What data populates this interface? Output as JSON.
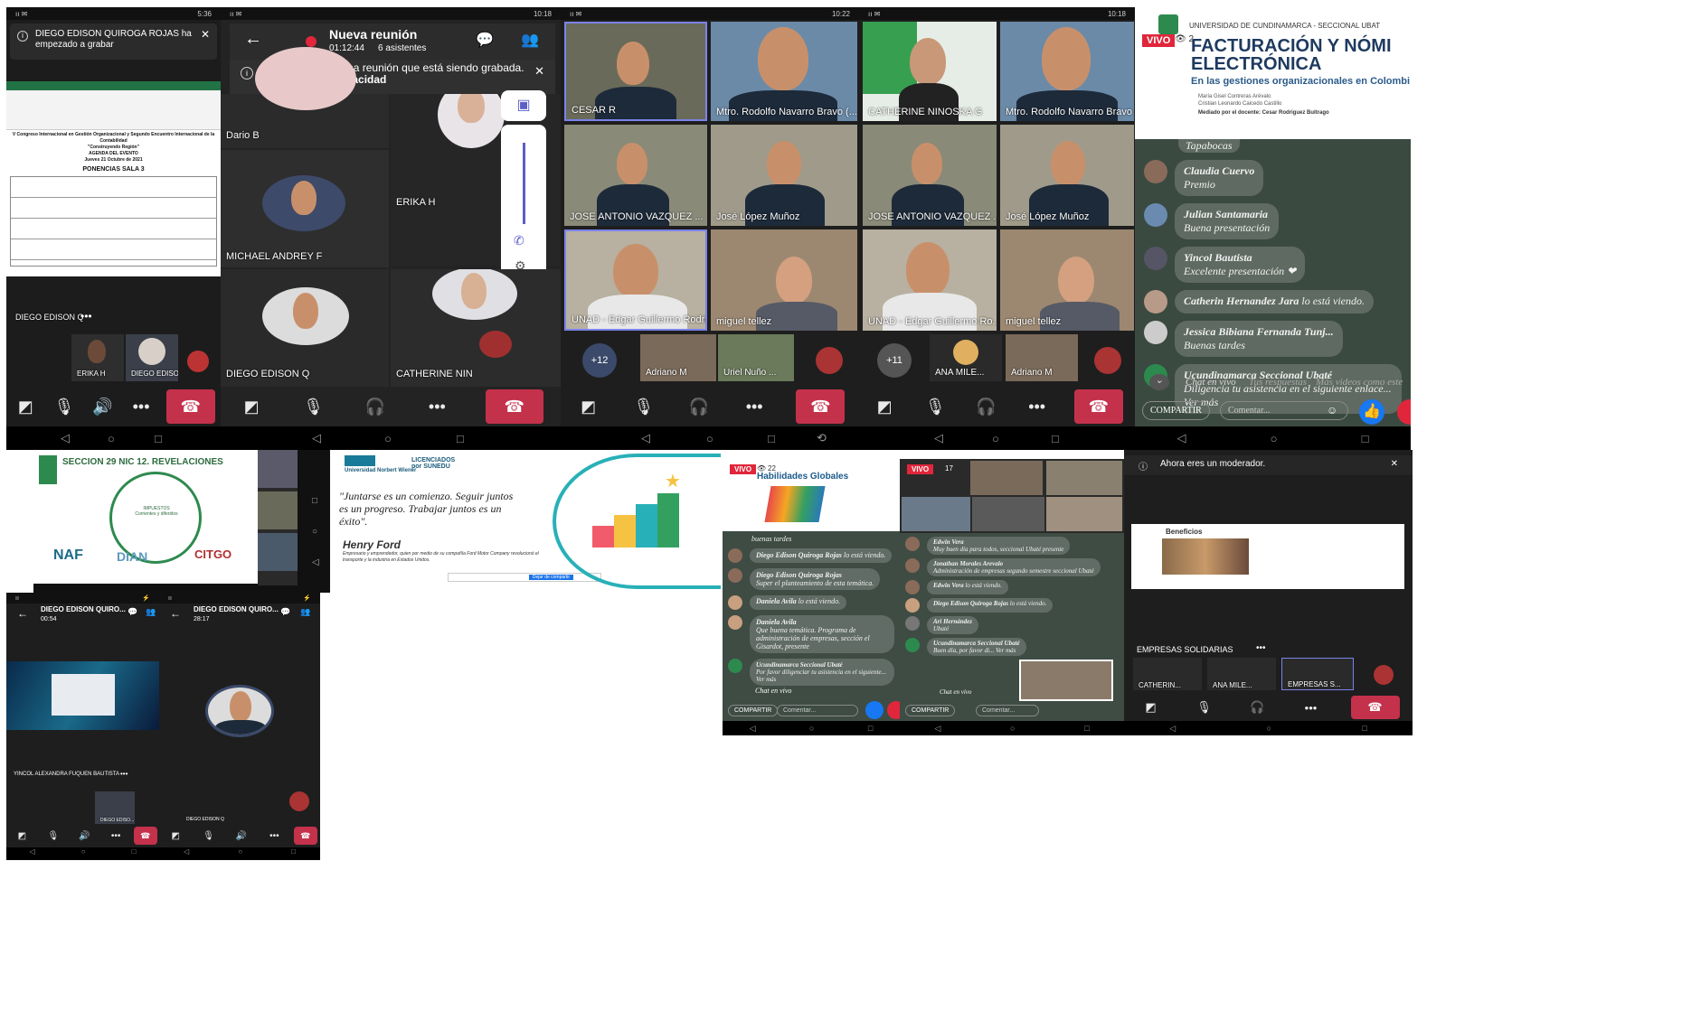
{
  "p1": {
    "status_time": "5:36",
    "notification": "DIEGO EDISON QUIROGA ROJAS ha empezado a grabar",
    "sheet_title": "V Congreso Internacional en Gestión Organizacional y Segundo Encuentro Internacional de la Contabilidad",
    "sheet_sub1": "\"Construyendo Región\"",
    "sheet_sub2": "AGENDA DEL EVENTO",
    "sheet_sub3": "Jueves 21 Octubre de 2021",
    "sheet_heading": "PONENCIAS SALA 3",
    "presenter": "DIEGO EDISON Q",
    "thumb1": "ERIKA H",
    "thumb2": "DIEGO EDISO..."
  },
  "p2": {
    "status_time": "10:18",
    "title": "Nueva reunión",
    "timer": "01:12:44",
    "attendees": "6 asistentes",
    "banner": "Te has unido a una reunión que está siendo grabada.",
    "banner_link": "Directiva de privacidad",
    "names": [
      "Dario B",
      "ERIKA H",
      "MICHAEL ANDREY F",
      "DIEGO EDISON Q",
      "CATHERINE NIN"
    ]
  },
  "p3": {
    "status_time": "10:22",
    "tiles": [
      "CESAR R",
      "Mtro. Rodolfo Navarro Bravo (...",
      "JOSE ANTONIO VAZQUEZ ...",
      "José López Muñoz",
      "UNAD - Edgar Guillermo Rodri...",
      "miguel tellez"
    ],
    "strip": [
      "+12",
      "Adriano M",
      "Uriel Nuño ..."
    ]
  },
  "p4": {
    "status_time": "10:18",
    "tiles": [
      "CATHERINE NINOSKA G",
      "Mtro. Rodolfo Navarro Bravo (...",
      "JOSE ANTONIO VAZQUEZ ...",
      "José López Muñoz",
      "UNAD - Edgar Guillermo Ro...",
      "miguel tellez"
    ],
    "strip": [
      "+11",
      "ANA MILE...",
      "Adriano M"
    ]
  },
  "p5": {
    "vivo": "VIVO",
    "slide_header": "UNIVERSIDAD DE CUNDINAMARCA - SECCIONAL UBAT",
    "slide_title1": "FACTURACIÓN Y NÓMI",
    "slide_title2": "ELECTRÓNICA",
    "slide_subtitle": "En las gestiones organizacionales en Colombi",
    "slide_authors1": "María Gisel Contreras Arévalo",
    "slide_authors2": "Cristian Leonardo Caicedo Castillo",
    "slide_mediator": "Mediado por el docente: Cesar Rodriguez Buitrago",
    "chat": [
      {
        "name": "",
        "text": "Tapabocas"
      },
      {
        "name": "Claudia Cuervo",
        "text": "Premio"
      },
      {
        "name": "Julian Santamaria",
        "text": "Buena presentación"
      },
      {
        "name": "Yincol Bautista",
        "text": "Excelente presentación ❤"
      },
      {
        "name": "Catherin Hernandez Jara",
        "text": "lo está viendo."
      },
      {
        "name": "Jessica Bibiana Fernanda Tunj...",
        "text": "Buenas tardes"
      },
      {
        "name": "Ucundinamarca Seccional Ubaté",
        "text": "Diligencia tu asistencia en el siguiente enlace... Ver más"
      }
    ],
    "tab_live": "Chat en vivo",
    "tab_answers": "Tus respuestas",
    "tab_more": "Más videos como este",
    "share": "COMPARTIR",
    "comment_placeholder": "Comentar..."
  },
  "p6": {
    "slide_title": "SECCION 29 NIC 12. REVELACIONES",
    "diagram_center": "IMPUESTOS Corrientes y diferidos",
    "logos": [
      "NAF",
      "DIAN",
      "CITGO"
    ]
  },
  "p7": {
    "brand": "Universidad Norbert Wiener",
    "badge": "LICENCIADOS por SUNEDU",
    "quote": "\"Juntarse es un comienzo. Seguir juntos es un progreso. Trabajar juntos es un éxito\".",
    "author": "Henry Ford",
    "author_desc": "Empresario y emprendedor, quien por medio de su compañía Ford Motor Company revolucionó el transporte y la industria en Estados Unidos.",
    "button": "Dejar de compartir"
  },
  "p8": {
    "vivo": "VIVO",
    "viewers": "22",
    "slide_title": "Habilidades Globales",
    "chat": [
      {
        "name": "",
        "text": "buenas tardes"
      },
      {
        "name": "Diego Edison Quiroga Rojas",
        "text": "lo está viendo."
      },
      {
        "name": "Diego Edison Quiroga Rojas",
        "text": "Super el planteamiento de esta temática."
      },
      {
        "name": "Daniela Avila",
        "text": "lo está viendo."
      },
      {
        "name": "Daniela Avila",
        "text": "Que buena temática. Programa de administración de empresas, sección el Gisardot, presente"
      },
      {
        "name": "Ucundinamarca Seccional Ubaté",
        "text": "Por favor diligenciar tu asistencia en el siguiente... Ver más"
      }
    ],
    "tab_live": "Chat en vivo",
    "share": "COMPARTIR",
    "comment_placeholder": "Comentar..."
  },
  "p9": {
    "vivo": "VIVO",
    "viewers": "17",
    "chat": [
      {
        "name": "Edwin Vera",
        "text": "Muy buen día para todos, seccional Ubaté presente"
      },
      {
        "name": "Jonathan Morales Arevalo",
        "text": "Administración de empresas segundo semestre seccional Ubaté"
      },
      {
        "name": "Edwin Vera",
        "text": "lo está viendo."
      },
      {
        "name": "Diego Edison Quiroga Rojas",
        "text": "lo está viendo."
      },
      {
        "name": "Ari Hernández",
        "text": "Ubaté"
      },
      {
        "name": "Ucundinamarca Seccional Ubaté",
        "text": "Buen día, por favor di... Ver más"
      }
    ],
    "tab_live": "Chat en vivo",
    "share": "COMPARTIR",
    "comment_placeholder": "Comentar..."
  },
  "p10": {
    "banner": "Ahora eres un moderador.",
    "slide_title": "Beneficios",
    "group_label": "EMPRESAS SOLIDARIAS",
    "strip": [
      "CATHERIN...",
      "ANA MILE...",
      "EMPRESAS S..."
    ]
  },
  "p11": {
    "title": "DIEGO EDISON QUIRO...",
    "timer": "00:54",
    "presenter": "YINCOL ALEXANDRA FUQUEN BAUTISTA",
    "thumb": "DIEGO EDISO..."
  },
  "p12": {
    "title": "DIEGO EDISON QUIRO...",
    "timer": "28:17",
    "presenter": "DIEGO EDISON Q"
  }
}
